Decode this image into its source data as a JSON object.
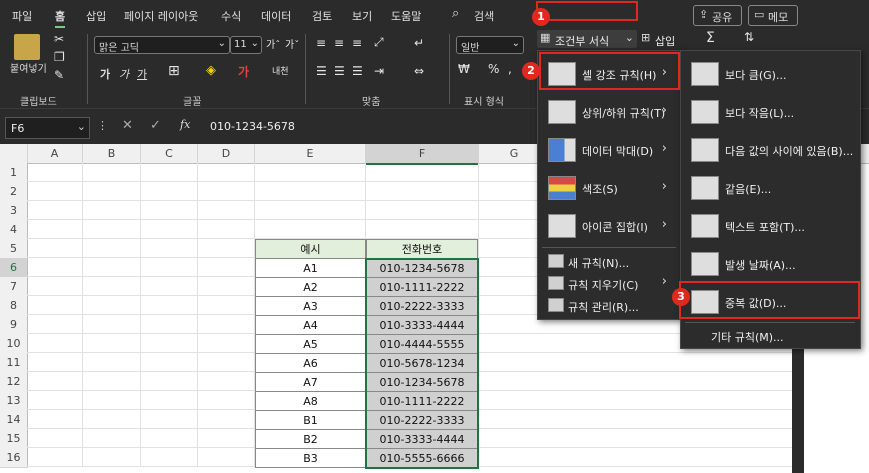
{
  "ribbon": {
    "tabs": [
      "파일",
      "홈",
      "삽입",
      "페이지 레이아웃",
      "수식",
      "데이터",
      "검토",
      "보기",
      "도움말"
    ],
    "search_label": "검색",
    "share_label": "공유",
    "memo_label": "메모",
    "clipboard": {
      "paste_label": "붙여넣기",
      "group_label": "클립보드"
    },
    "font": {
      "name": "맑은 고딕",
      "size": "11",
      "group_label": "글꼴",
      "bold": "가",
      "italic": "가",
      "underline": "가"
    },
    "alignment": {
      "group_label": "맞춤"
    },
    "number": {
      "format": "일반",
      "group_label": "표시 형식"
    },
    "conditional_formatting_label": "조건부 서식",
    "insert_label": "삽입"
  },
  "formula_bar": {
    "name_box": "F6",
    "fx": "fx",
    "value": "010-1234-5678"
  },
  "columns": [
    "A",
    "B",
    "C",
    "D",
    "E",
    "F",
    "G"
  ],
  "rows": [
    "1",
    "2",
    "3",
    "4",
    "5",
    "6",
    "7",
    "8",
    "9",
    "10",
    "11",
    "12",
    "13",
    "14",
    "15",
    "16"
  ],
  "table": {
    "headers": [
      "예시",
      "전화번호"
    ],
    "rows": [
      [
        "A1",
        "010-1234-5678"
      ],
      [
        "A2",
        "010-1111-2222"
      ],
      [
        "A3",
        "010-2222-3333"
      ],
      [
        "A4",
        "010-3333-4444"
      ],
      [
        "A5",
        "010-4444-5555"
      ],
      [
        "A6",
        "010-5678-1234"
      ],
      [
        "A7",
        "010-1234-5678"
      ],
      [
        "A8",
        "010-1111-2222"
      ],
      [
        "B1",
        "010-2222-3333"
      ],
      [
        "B2",
        "010-3333-4444"
      ],
      [
        "B3",
        "010-5555-6666"
      ]
    ]
  },
  "cf_menu": {
    "items": [
      "셀 강조 규칙(H)",
      "상위/하위 규칙(T)",
      "데이터 막대(D)",
      "색조(S)",
      "아이콘 집합(I)"
    ],
    "small_items": [
      "새 규칙(N)...",
      "규칙 지우기(C)",
      "규칙 관리(R)..."
    ]
  },
  "highlight_menu": {
    "items": [
      "보다 큼(G)...",
      "보다 작음(L)...",
      "다음 값의 사이에 있음(B)...",
      "같음(E)...",
      "텍스트 포함(T)...",
      "발생 날짜(A)...",
      "중복 값(D)..."
    ],
    "more": "기타 규칙(M)..."
  },
  "badges": [
    "1",
    "2",
    "3"
  ],
  "colors": {
    "header_fill": "#e2efda",
    "selected_fill": "#d0d0d0",
    "highlight_box": "#e0281e",
    "accent": "#217346"
  }
}
